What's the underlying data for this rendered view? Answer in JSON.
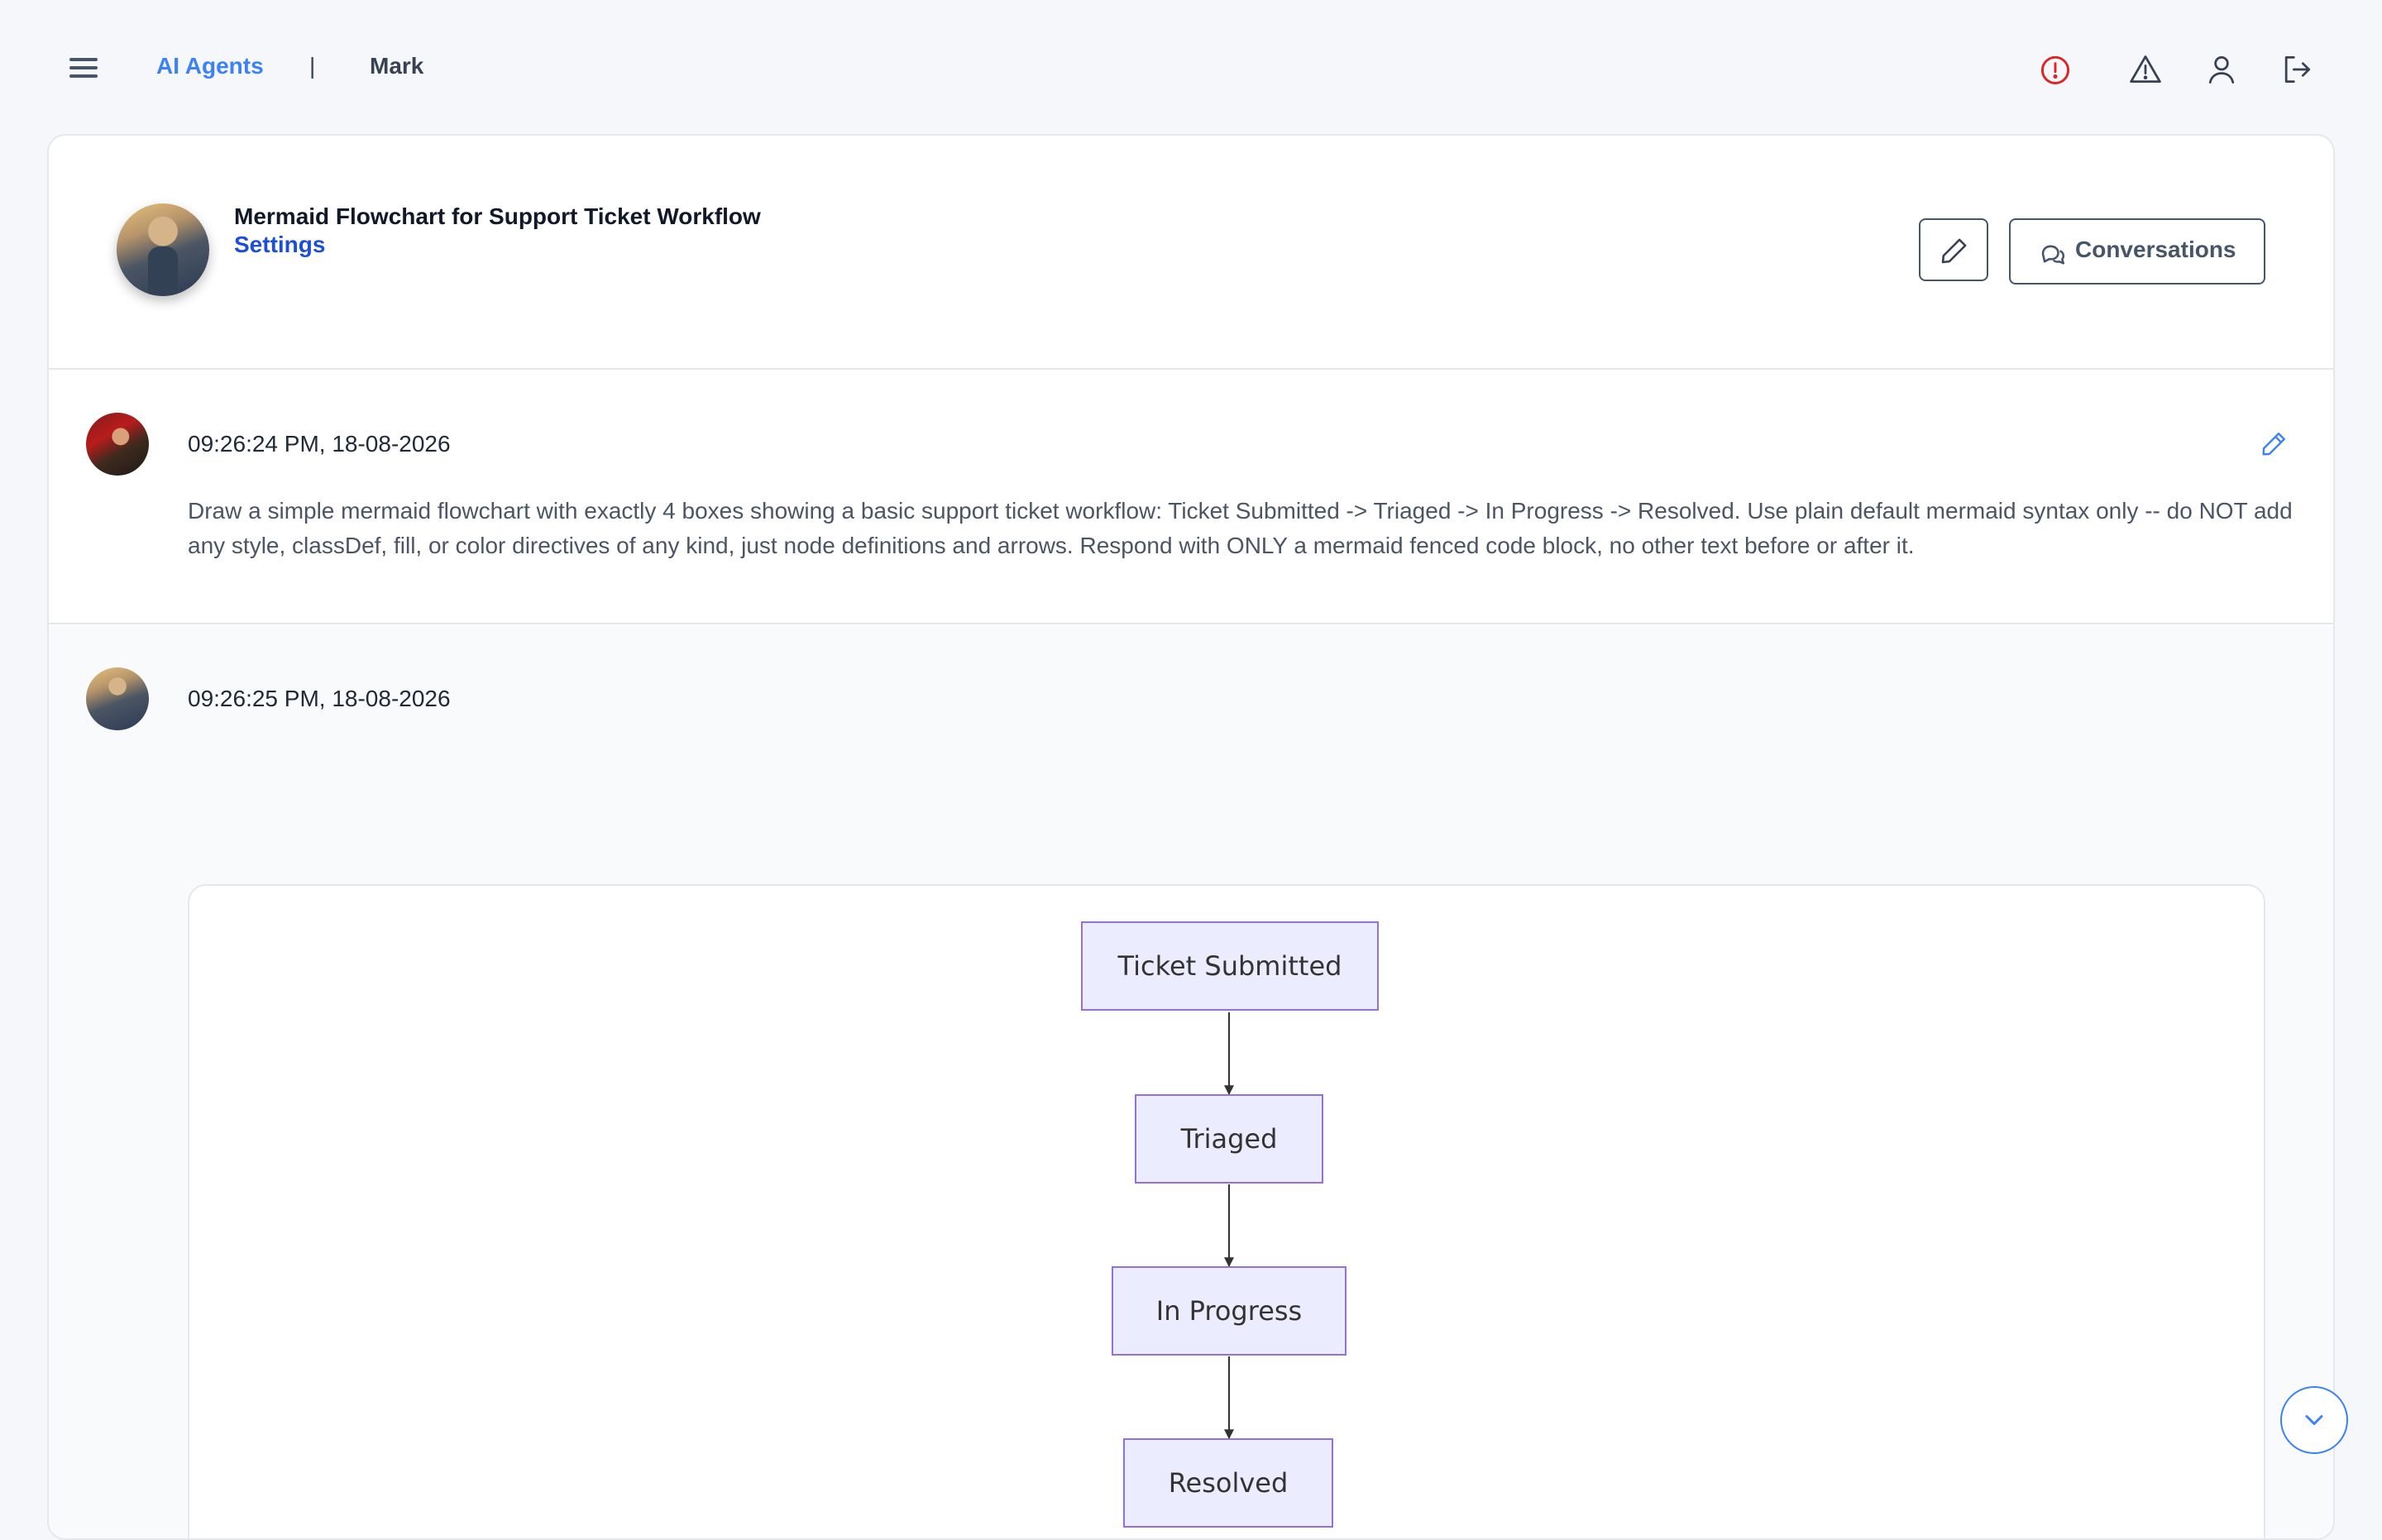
{
  "topbar": {
    "breadcrumb_link": "AI Agents",
    "separator": "|",
    "breadcrumb_current": "Mark",
    "icons": [
      "menu-icon",
      "alert-circle-icon",
      "warning-triangle-icon",
      "user-icon",
      "logout-icon"
    ],
    "alert_color": "#dc2626",
    "link_color": "#3b82f6"
  },
  "agent": {
    "title": "Mermaid Flowchart for Support Ticket Workflow",
    "settings_label": "Settings",
    "conversations_label": "Conversations"
  },
  "messages": [
    {
      "role": "user",
      "timestamp": "09:26:24 PM, 18-08-2026",
      "text": "Draw a simple mermaid flowchart with exactly 4 boxes showing a basic support ticket workflow: Ticket Submitted -> Triaged -> In Progress -> Resolved. Use plain default mermaid syntax only -- do NOT add any style, classDef, fill, or color directives of any kind, just node definitions and arrows. Respond with ONLY a mermaid fenced code block, no other text before or after it."
    },
    {
      "role": "agent",
      "timestamp": "09:26:25 PM, 18-08-2026",
      "diagram": {
        "type": "flowchart",
        "direction": "top-down",
        "nodes": [
          "Ticket Submitted",
          "Triaged",
          "In Progress",
          "Resolved"
        ],
        "edges": [
          [
            "Ticket Submitted",
            "Triaged"
          ],
          [
            "Triaged",
            "In Progress"
          ],
          [
            "In Progress",
            "Resolved"
          ]
        ],
        "node_fill": "#ececff",
        "node_stroke": "#9370db"
      }
    }
  ]
}
